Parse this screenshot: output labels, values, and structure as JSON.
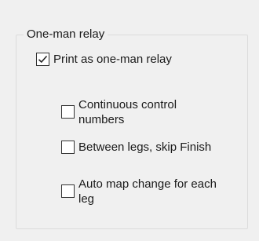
{
  "group": {
    "title": "One-man relay"
  },
  "options": {
    "print_as_relay": {
      "label": "Print as one-man relay",
      "checked": true
    },
    "continuous_control_numbers": {
      "label": "Continuous control numbers",
      "checked": false
    },
    "skip_finish": {
      "label": "Between legs, skip Finish",
      "checked": false
    },
    "auto_map_change": {
      "label": "Auto map change for each leg",
      "checked": false
    }
  },
  "icons": {
    "checkmark": "checkmark-icon"
  }
}
